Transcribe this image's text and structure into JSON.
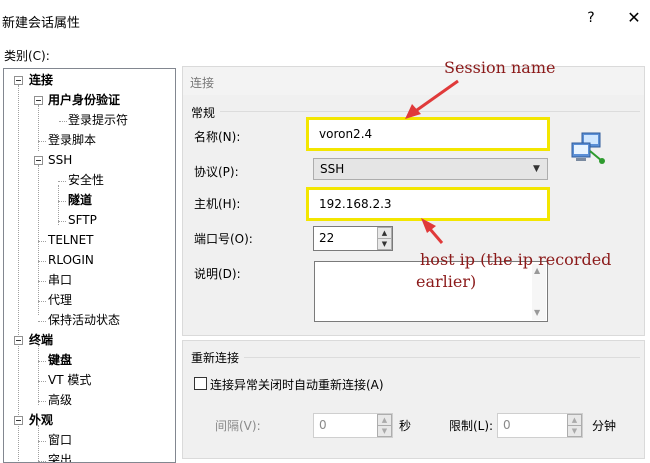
{
  "window": {
    "title": "新建会话属性",
    "help": "?",
    "close": "✕"
  },
  "category_label": "类别(C):",
  "tree": [
    {
      "label": "连接",
      "bold": true
    },
    {
      "label": "用户身份验证",
      "bold": true
    },
    {
      "label": "登录提示符",
      "bold": false
    },
    {
      "label": "登录脚本",
      "bold": false
    },
    {
      "label": "SSH",
      "bold": false
    },
    {
      "label": "安全性",
      "bold": false
    },
    {
      "label": "隧道",
      "bold": true
    },
    {
      "label": "SFTP",
      "bold": false
    },
    {
      "label": "TELNET",
      "bold": false
    },
    {
      "label": "RLOGIN",
      "bold": false
    },
    {
      "label": "串口",
      "bold": false
    },
    {
      "label": "代理",
      "bold": false
    },
    {
      "label": "保持活动状态",
      "bold": false
    },
    {
      "label": "终端",
      "bold": true
    },
    {
      "label": "键盘",
      "bold": true
    },
    {
      "label": "VT 模式",
      "bold": false
    },
    {
      "label": "高级",
      "bold": false
    },
    {
      "label": "外观",
      "bold": true
    },
    {
      "label": "窗口",
      "bold": false
    },
    {
      "label": "突出",
      "bold": false
    }
  ],
  "panel": {
    "section_header": "连接",
    "general_group": "常规",
    "name_label": "名称(N):",
    "name_value": "voron2.4",
    "protocol_label": "协议(P):",
    "protocol_value": "SSH",
    "host_label": "主机(H):",
    "host_value": "192.168.2.3",
    "port_label": "端口号(O):",
    "port_value": "22",
    "desc_label": "说明(D):",
    "desc_value": ""
  },
  "reconnect": {
    "group": "重新连接",
    "checkbox_label": "连接异常关闭时自动重新连接(A)",
    "checked": false,
    "interval_label": "间隔(V):",
    "interval_value": "0",
    "interval_unit": "秒",
    "limit_label": "限制(L):",
    "limit_value": "0",
    "limit_unit": "分钟"
  },
  "annotations": {
    "session": "Session name",
    "host_line1": "host ip (the ip recorded",
    "host_line2": "earlier)",
    "color": "#e03a3a"
  }
}
